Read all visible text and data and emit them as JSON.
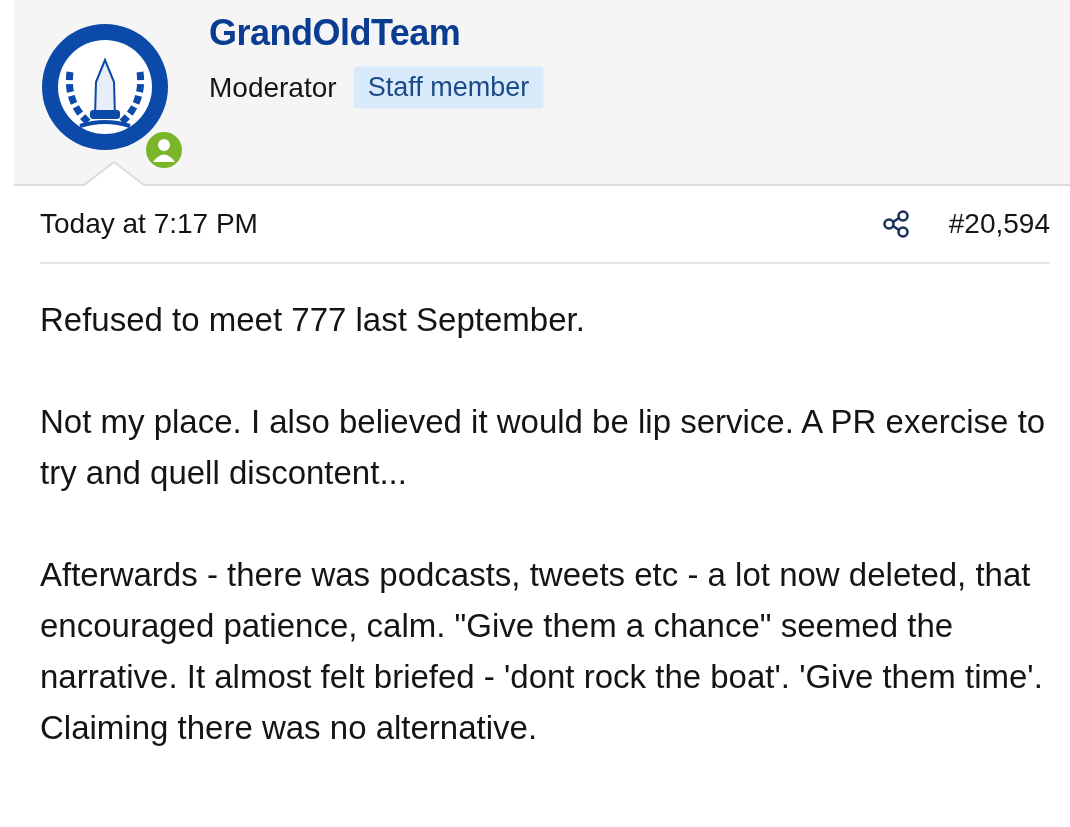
{
  "author": {
    "name": "GrandOldTeam",
    "role": "Moderator",
    "badge": "Staff member",
    "online": true
  },
  "post": {
    "time": "Today at 7:17 PM",
    "number": "#20,594",
    "paragraphs": [
      "Refused to meet 777 last September.",
      "Not my place. I also believed it would be lip service. A PR exercise to try and quell discontent...",
      "Afterwards - there was podcasts, tweets etc - a lot now deleted, that encouraged patience, calm. \"Give them a chance\" seemed the narrative. It almost felt briefed - 'dont rock the boat'. 'Give them time'. Claiming there was no alternative."
    ]
  }
}
